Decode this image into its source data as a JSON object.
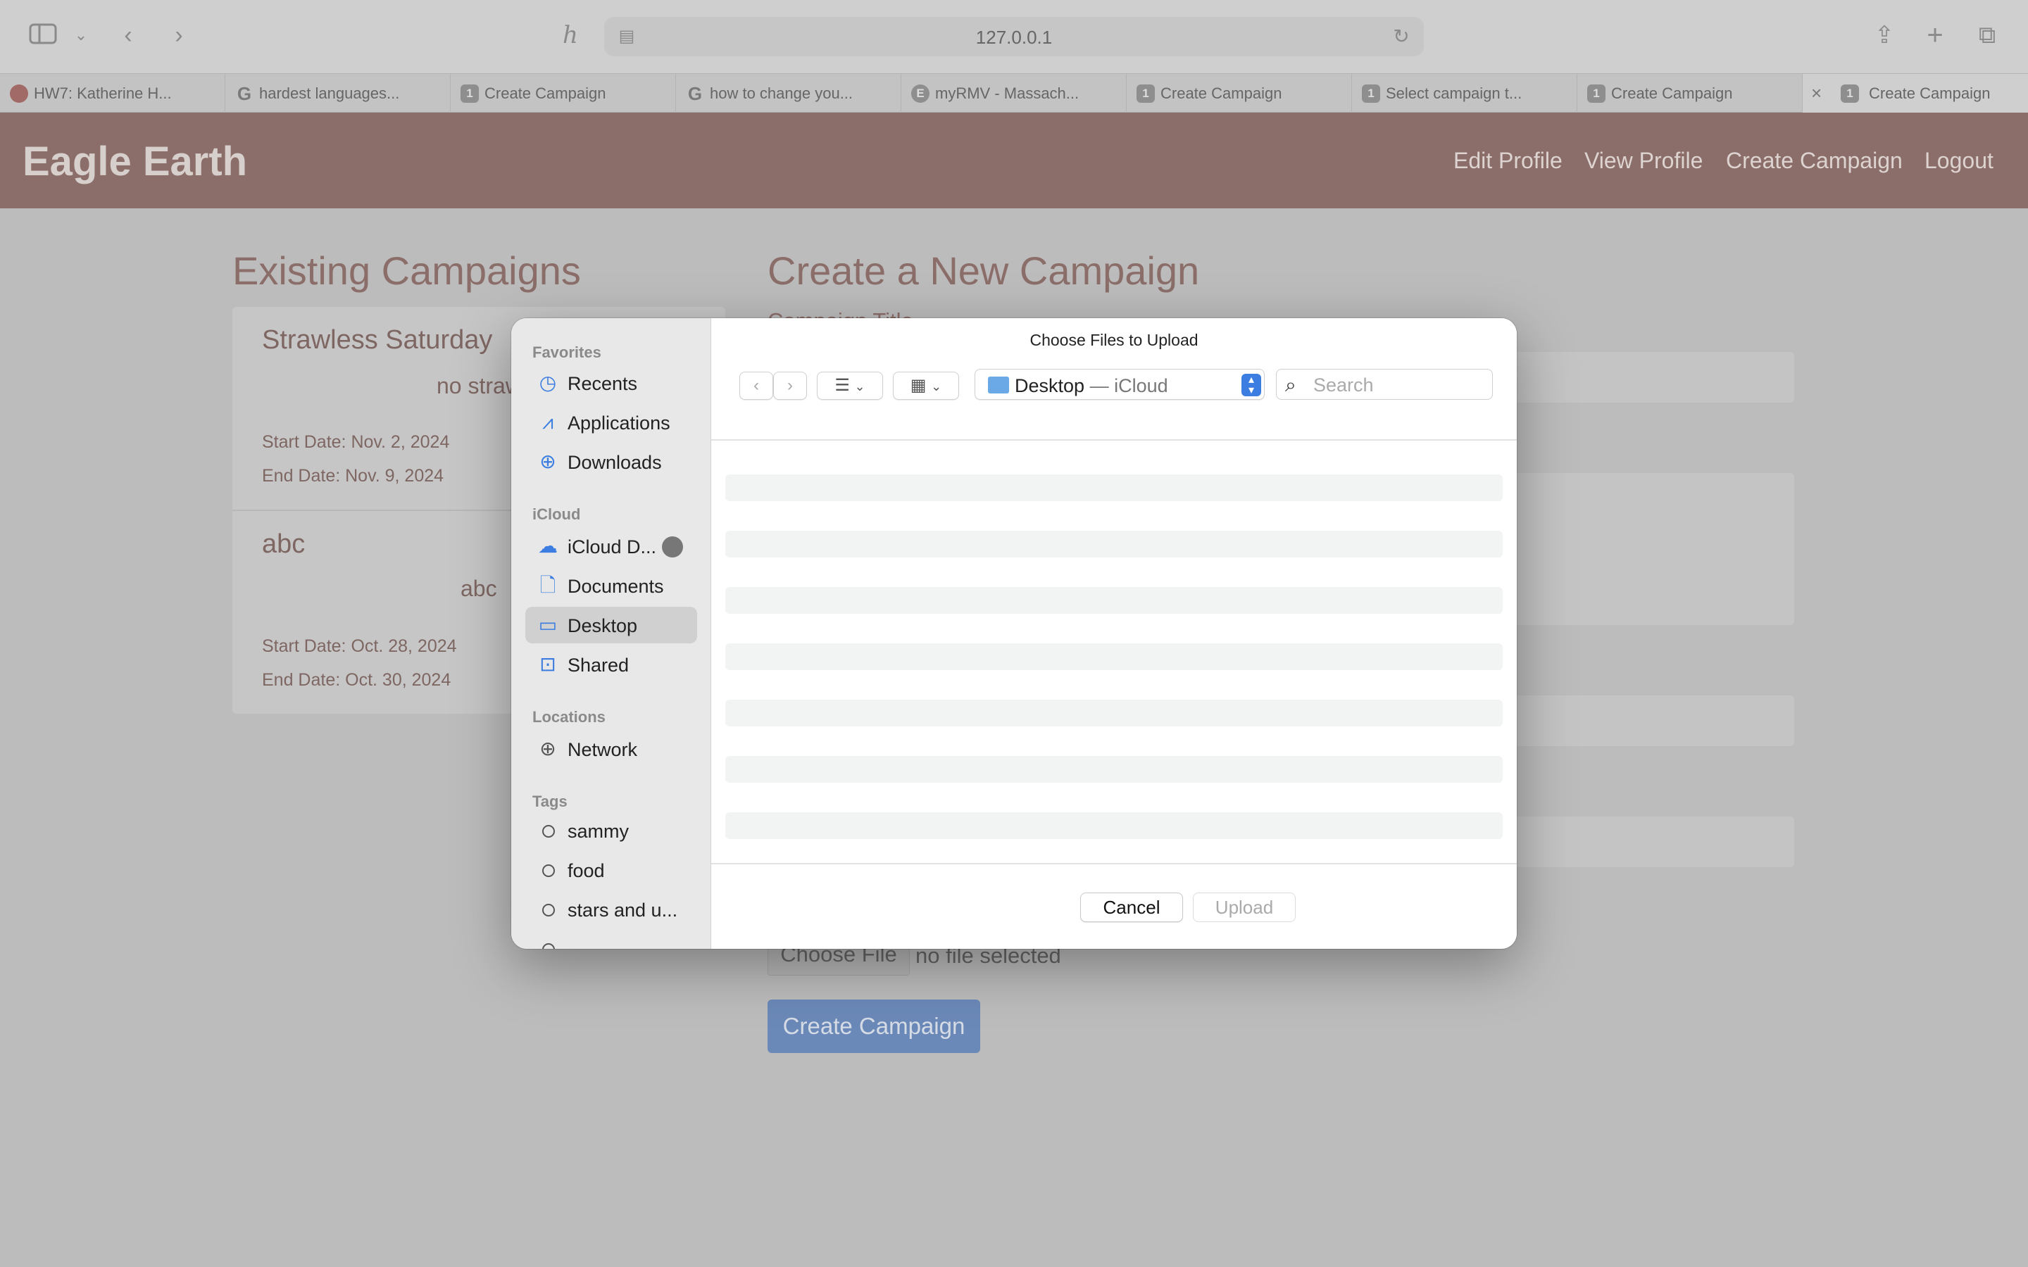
{
  "browser": {
    "url": "127.0.0.1",
    "tabs": [
      {
        "label": "HW7: Katherine H...",
        "favicon": "H"
      },
      {
        "label": "hardest languages...",
        "favicon": "G"
      },
      {
        "label": "Create Campaign",
        "favicon": "1"
      },
      {
        "label": "how to change you...",
        "favicon": "G"
      },
      {
        "label": "myRMV - Massach...",
        "favicon": "E"
      },
      {
        "label": "Create Campaign",
        "favicon": "1"
      },
      {
        "label": "Select campaign t...",
        "favicon": "1"
      },
      {
        "label": "Create Campaign",
        "favicon": "1"
      },
      {
        "label": "Create Campaign",
        "favicon": "1"
      }
    ]
  },
  "site": {
    "brand": "Eagle Earth",
    "nav": [
      "Edit Profile",
      "View Profile",
      "Create Campaign",
      "Logout"
    ],
    "colors": {
      "header": "#8b6e69",
      "accent": "#6b89b8"
    }
  },
  "existing": {
    "heading": "Existing Campaigns",
    "campaigns": [
      {
        "title": "Strawless Saturday",
        "desc": "no straw",
        "start": "Start Date: Nov. 2, 2024",
        "end": "End Date: Nov. 9, 2024"
      },
      {
        "title": "abc",
        "desc": "abc",
        "start": "Start Date: Oct. 28, 2024",
        "end": "End Date: Oct. 30, 2024"
      }
    ]
  },
  "create_form": {
    "heading": "Create a New Campaign",
    "title_label": "Campaign Title",
    "choose_file": "Choose File",
    "no_file": "no file selected",
    "submit": "Create Campaign"
  },
  "dialog": {
    "title": "Choose Files to Upload",
    "location": "Desktop",
    "location_sub": "— iCloud",
    "search_placeholder": "Search",
    "cancel": "Cancel",
    "upload": "Upload",
    "sidebar": {
      "favorites_header": "Favorites",
      "favorites": [
        {
          "label": "Recents",
          "icon": "clock-icon"
        },
        {
          "label": "Applications",
          "icon": "applications-icon"
        },
        {
          "label": "Downloads",
          "icon": "download-icon"
        }
      ],
      "icloud_header": "iCloud",
      "icloud": [
        {
          "label": "iCloud D...",
          "icon": "cloud-icon"
        },
        {
          "label": "Documents",
          "icon": "document-icon"
        },
        {
          "label": "Desktop",
          "icon": "desktop-icon",
          "selected": true
        },
        {
          "label": "Shared",
          "icon": "shared-folder-icon"
        }
      ],
      "locations_header": "Locations",
      "locations": [
        {
          "label": "Network",
          "icon": "globe-icon"
        }
      ],
      "tags_header": "Tags",
      "tags": [
        "sammy",
        "food",
        "stars and u..."
      ]
    }
  }
}
